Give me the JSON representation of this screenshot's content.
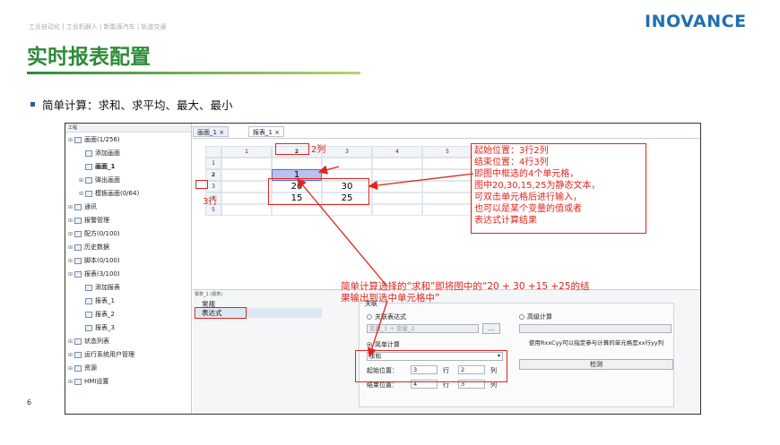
{
  "header": {
    "nav": "工业自动化  |  工业机器人  |  新能源汽车  |  轨道交通",
    "logo": "INOVANCE",
    "title": "实时报表配置",
    "subtitle": "简单计算：求和、求平均、最大、最小",
    "page_number": "6"
  },
  "tree": {
    "header": "工程",
    "items": [
      {
        "label": "画面(1/256)",
        "icon": "screen-icon"
      },
      {
        "label": "添加画面",
        "icon": "add-screen-icon"
      },
      {
        "label": "画面_1",
        "icon": "screen-icon"
      },
      {
        "label": "弹出画面",
        "icon": "popup-icon"
      },
      {
        "label": "模板画面(0/64)",
        "icon": "template-icon"
      },
      {
        "label": "通讯",
        "icon": "comm-icon"
      },
      {
        "label": "报警管理",
        "icon": "alarm-icon"
      },
      {
        "label": "配方(0/100)",
        "icon": "recipe-icon"
      },
      {
        "label": "历史数据",
        "icon": "history-icon"
      },
      {
        "label": "脚本(0/100)",
        "icon": "script-icon"
      },
      {
        "label": "报表(3/100)",
        "icon": "report-icon"
      },
      {
        "label": "添加报表",
        "icon": "add-report-icon"
      },
      {
        "label": "报表_1",
        "icon": "report-icon"
      },
      {
        "label": "报表_2",
        "icon": "report-icon"
      },
      {
        "label": "报表_3",
        "icon": "report-icon"
      },
      {
        "label": "状态列表",
        "icon": "status-list-icon"
      },
      {
        "label": "运行系统用户管理",
        "icon": "user-mgmt-icon"
      },
      {
        "label": "资源",
        "icon": "resource-icon"
      },
      {
        "label": "HMI设置",
        "icon": "settings-icon"
      }
    ]
  },
  "tabs": [
    {
      "label": "画面_1"
    },
    {
      "label": "报表_1"
    }
  ],
  "grid": {
    "col_headers": [
      "1",
      "2",
      "3",
      "4",
      "5"
    ],
    "row_headers": [
      "1",
      "2",
      "3",
      "4",
      "5"
    ],
    "cell_2_2": "1",
    "cell_3_2": "20",
    "cell_3_3": "30",
    "cell_4_2": "15",
    "cell_4_3": "25"
  },
  "annotations": {
    "col_label": "2列",
    "row_label": "3行",
    "main_lines": [
      "起始位置：3行2列",
      "结束位置：4行3列",
      "即图中框选的4个单元格，",
      "图中20,30,15,25为静态文本，",
      "可双击单元格后进行输入，",
      "也可以是某个变量的值或者",
      "表达式计算结果"
    ],
    "bottom_lines": [
      "简单计算选择的“求和”即将图中的“20 + 30 +15 +25的结",
      "果输出到选中单元格中”"
    ]
  },
  "props": {
    "header": "报表_1 (报表)",
    "list": [
      "常规",
      "表达式"
    ],
    "group_title": "关联",
    "radio_expr": "关联表达式",
    "radio_adv": "高级计算",
    "expr_value": "变量_1 + 变量_2",
    "browse": "...",
    "radio_simple": "简单计算",
    "calc_value": "求和",
    "start_label": "起始位置：",
    "start_row": "3",
    "start_col": "2",
    "end_label": "结束位置：",
    "end_row": "4",
    "end_col": "3",
    "row_unit": "行",
    "col_unit": "列",
    "adv_note": "使用RxxCyy可以指定参与计算的单元格是xx行yy列",
    "check_button": "检测"
  },
  "colors": {
    "accent_green": "#2d8b39",
    "brand_blue": "#1f6fb3",
    "annotation_red": "#e0241c"
  }
}
